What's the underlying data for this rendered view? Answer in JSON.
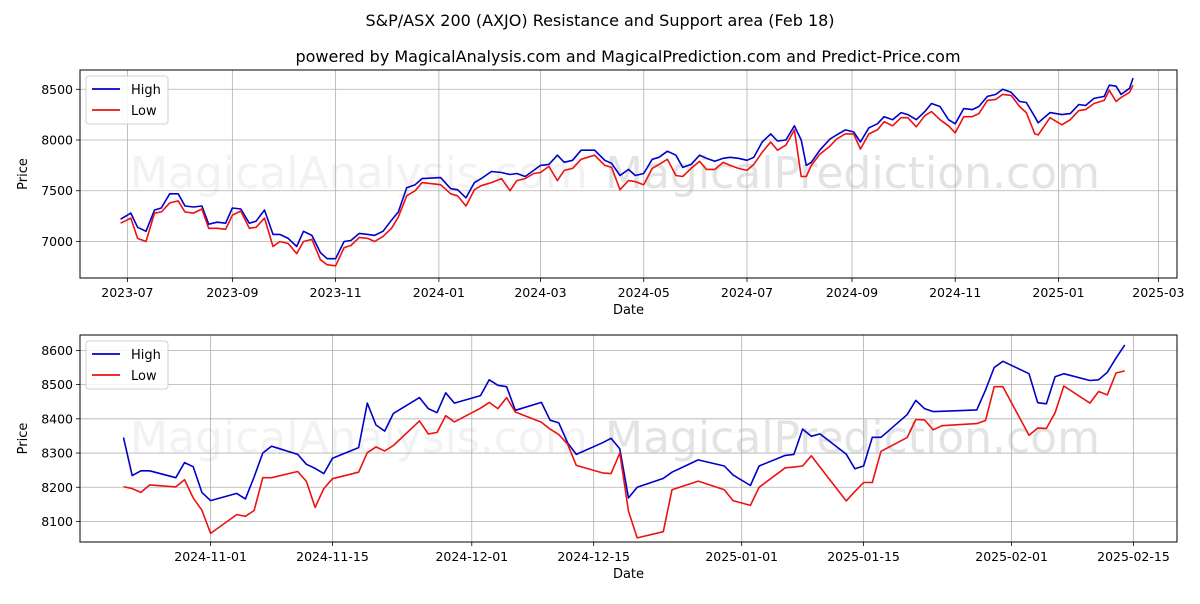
{
  "title": "S&P/ASX 200 (AXJO) Resistance and Support area (Feb 18)",
  "subtitle": "powered by MagicalAnalysis.com and MagicalPrediction.com and Predict-Price.com",
  "watermarks": [
    "MagicalAnalysis.com",
    "MagicalPrediction.com"
  ],
  "colors": {
    "high": "#0000cc",
    "low": "#ee1111",
    "grid": "#b0b0b0"
  },
  "chart_data": [
    {
      "type": "line",
      "title": "",
      "xlabel": "Date",
      "ylabel": "Price",
      "grid": true,
      "legend": {
        "placement": "top-left",
        "entries": [
          "High",
          "Low"
        ]
      },
      "xlim": [
        "2023-06-03",
        "2025-03-12"
      ],
      "ylim": [
        6640,
        8690
      ],
      "x_ticks": [
        "2023-07",
        "2023-09",
        "2023-11",
        "2024-01",
        "2024-03",
        "2024-05",
        "2024-07",
        "2024-09",
        "2024-11",
        "2025-01",
        "2025-03"
      ],
      "y_ticks": [
        7000,
        7500,
        8000,
        8500
      ],
      "x": [
        "2023-06-27",
        "2023-07-03",
        "2023-07-07",
        "2023-07-12",
        "2023-07-17",
        "2023-07-21",
        "2023-07-26",
        "2023-07-31",
        "2023-08-04",
        "2023-08-09",
        "2023-08-14",
        "2023-08-18",
        "2023-08-23",
        "2023-08-28",
        "2023-09-01",
        "2023-09-06",
        "2023-09-11",
        "2023-09-15",
        "2023-09-20",
        "2023-09-25",
        "2023-09-29",
        "2023-10-04",
        "2023-10-09",
        "2023-10-13",
        "2023-10-18",
        "2023-10-23",
        "2023-10-27",
        "2023-11-01",
        "2023-11-06",
        "2023-11-10",
        "2023-11-15",
        "2023-11-20",
        "2023-11-24",
        "2023-11-29",
        "2023-12-04",
        "2023-12-08",
        "2023-12-13",
        "2023-12-18",
        "2023-12-22",
        "2024-01-02",
        "2024-01-08",
        "2024-01-12",
        "2024-01-17",
        "2024-01-22",
        "2024-01-26",
        "2024-02-01",
        "2024-02-07",
        "2024-02-12",
        "2024-02-16",
        "2024-02-21",
        "2024-02-26",
        "2024-03-01",
        "2024-03-06",
        "2024-03-11",
        "2024-03-15",
        "2024-03-20",
        "2024-03-25",
        "2024-04-02",
        "2024-04-08",
        "2024-04-12",
        "2024-04-17",
        "2024-04-22",
        "2024-04-26",
        "2024-05-01",
        "2024-05-06",
        "2024-05-10",
        "2024-05-15",
        "2024-05-20",
        "2024-05-24",
        "2024-05-29",
        "2024-06-03",
        "2024-06-07",
        "2024-06-12",
        "2024-06-17",
        "2024-06-21",
        "2024-06-26",
        "2024-07-01",
        "2024-07-05",
        "2024-07-10",
        "2024-07-15",
        "2024-07-19",
        "2024-07-24",
        "2024-07-29",
        "2024-08-02",
        "2024-08-05",
        "2024-08-08",
        "2024-08-13",
        "2024-08-19",
        "2024-08-23",
        "2024-08-28",
        "2024-09-02",
        "2024-09-06",
        "2024-09-11",
        "2024-09-16",
        "2024-09-20",
        "2024-09-25",
        "2024-09-30",
        "2024-10-04",
        "2024-10-09",
        "2024-10-14",
        "2024-10-18",
        "2024-10-23",
        "2024-10-28",
        "2024-11-01",
        "2024-11-06",
        "2024-11-11",
        "2024-11-15",
        "2024-11-20",
        "2024-11-25",
        "2024-11-29",
        "2024-12-04",
        "2024-12-09",
        "2024-12-13",
        "2024-12-18",
        "2024-12-20",
        "2024-12-27",
        "2025-01-03",
        "2025-01-08",
        "2025-01-13",
        "2025-01-17",
        "2025-01-22",
        "2025-01-28",
        "2025-01-31",
        "2025-02-04",
        "2025-02-07",
        "2025-02-12",
        "2025-02-14"
      ],
      "series": [
        {
          "name": "High",
          "values": [
            7220,
            7280,
            7140,
            7100,
            7310,
            7330,
            7470,
            7470,
            7350,
            7340,
            7350,
            7170,
            7190,
            7180,
            7330,
            7320,
            7180,
            7200,
            7310,
            7070,
            7070,
            7030,
            6950,
            7100,
            7060,
            6890,
            6830,
            6830,
            7000,
            7010,
            7080,
            7070,
            7060,
            7100,
            7210,
            7290,
            7530,
            7560,
            7620,
            7630,
            7520,
            7510,
            7430,
            7580,
            7620,
            7690,
            7680,
            7660,
            7670,
            7640,
            7700,
            7750,
            7760,
            7850,
            7780,
            7800,
            7900,
            7900,
            7800,
            7770,
            7650,
            7710,
            7650,
            7670,
            7810,
            7830,
            7890,
            7850,
            7730,
            7760,
            7850,
            7820,
            7790,
            7820,
            7830,
            7820,
            7800,
            7830,
            7980,
            8060,
            7990,
            8000,
            8140,
            8000,
            7750,
            7780,
            7900,
            8010,
            8050,
            8100,
            8080,
            7980,
            8120,
            8160,
            8230,
            8200,
            8270,
            8250,
            8200,
            8280,
            8360,
            8330,
            8200,
            8160,
            8310,
            8300,
            8330,
            8430,
            8450,
            8500,
            8470,
            8380,
            8370,
            8230,
            8170,
            8270,
            8250,
            8260,
            8350,
            8340,
            8410,
            8430,
            8540,
            8530,
            8450,
            8510,
            8610
          ]
        },
        {
          "name": "Low",
          "values": [
            7180,
            7230,
            7030,
            7000,
            7280,
            7290,
            7380,
            7400,
            7290,
            7280,
            7320,
            7130,
            7130,
            7120,
            7260,
            7300,
            7130,
            7140,
            7230,
            6950,
            7000,
            6980,
            6880,
            7000,
            7020,
            6820,
            6770,
            6760,
            6940,
            6960,
            7040,
            7030,
            7000,
            7050,
            7130,
            7240,
            7450,
            7500,
            7580,
            7560,
            7470,
            7450,
            7350,
            7510,
            7550,
            7580,
            7620,
            7500,
            7600,
            7620,
            7670,
            7680,
            7740,
            7600,
            7700,
            7720,
            7810,
            7850,
            7750,
            7730,
            7510,
            7600,
            7590,
            7560,
            7720,
            7760,
            7810,
            7650,
            7640,
            7720,
            7790,
            7710,
            7710,
            7780,
            7750,
            7720,
            7700,
            7760,
            7880,
            7980,
            7900,
            7950,
            8100,
            7640,
            7640,
            7750,
            7860,
            7940,
            8010,
            8060,
            8060,
            7910,
            8060,
            8100,
            8180,
            8140,
            8220,
            8220,
            8130,
            8240,
            8280,
            8200,
            8140,
            8070,
            8230,
            8230,
            8260,
            8390,
            8400,
            8450,
            8440,
            8330,
            8270,
            8060,
            8050,
            8220,
            8150,
            8200,
            8290,
            8300,
            8360,
            8390,
            8490,
            8380,
            8420,
            8470,
            8540
          ]
        }
      ]
    },
    {
      "type": "line",
      "title": "",
      "xlabel": "Date",
      "ylabel": "Price",
      "grid": true,
      "legend": {
        "placement": "top-left",
        "entries": [
          "High",
          "Low"
        ]
      },
      "xlim": [
        "2024-10-17",
        "2025-02-20"
      ],
      "ylim": [
        8040,
        8645
      ],
      "x_ticks": [
        "2024-11-01",
        "2024-11-15",
        "2024-12-01",
        "2024-12-15",
        "2025-01-01",
        "2025-01-15",
        "2025-02-01",
        "2025-02-15"
      ],
      "x_tick_labels": [
        "2024-11-01",
        "2024-11-15",
        "2024-12-01",
        "2024-12-15",
        "2025-01-01",
        "2025-01-15",
        "2025-02-01",
        "2025-02-15"
      ],
      "y_ticks": [
        8100,
        8200,
        8300,
        8400,
        8500,
        8600
      ],
      "x": [
        "2024-10-22",
        "2024-10-23",
        "2024-10-24",
        "2024-10-25",
        "2024-10-28",
        "2024-10-29",
        "2024-10-30",
        "2024-10-31",
        "2024-11-01",
        "2024-11-04",
        "2024-11-05",
        "2024-11-06",
        "2024-11-07",
        "2024-11-08",
        "2024-11-11",
        "2024-11-12",
        "2024-11-13",
        "2024-11-14",
        "2024-11-15",
        "2024-11-18",
        "2024-11-19",
        "2024-11-20",
        "2024-11-21",
        "2024-11-22",
        "2024-11-25",
        "2024-11-26",
        "2024-11-27",
        "2024-11-28",
        "2024-11-29",
        "2024-12-02",
        "2024-12-03",
        "2024-12-04",
        "2024-12-05",
        "2024-12-06",
        "2024-12-09",
        "2024-12-10",
        "2024-12-11",
        "2024-12-12",
        "2024-12-13",
        "2024-12-16",
        "2024-12-17",
        "2024-12-18",
        "2024-12-19",
        "2024-12-20",
        "2024-12-23",
        "2024-12-24",
        "2024-12-27",
        "2024-12-30",
        "2024-12-31",
        "2025-01-02",
        "2025-01-03",
        "2025-01-06",
        "2025-01-07",
        "2025-01-08",
        "2025-01-09",
        "2025-01-10",
        "2025-01-13",
        "2025-01-14",
        "2025-01-15",
        "2025-01-16",
        "2025-01-17",
        "2025-01-20",
        "2025-01-21",
        "2025-01-22",
        "2025-01-23",
        "2025-01-24",
        "2025-01-28",
        "2025-01-29",
        "2025-01-30",
        "2025-01-31",
        "2025-02-03",
        "2025-02-04",
        "2025-02-05",
        "2025-02-06",
        "2025-02-07",
        "2025-02-10",
        "2025-02-11",
        "2025-02-12",
        "2025-02-13",
        "2025-02-14"
      ],
      "series": [
        {
          "name": "High",
          "values": [
            8345,
            8234,
            8248,
            8248,
            8228,
            8272,
            8260,
            8185,
            8161,
            8182,
            8166,
            8230,
            8300,
            8320,
            8296,
            8267,
            8255,
            8240,
            8285,
            8316,
            8446,
            8382,
            8364,
            8416,
            8462,
            8430,
            8418,
            8476,
            8446,
            8468,
            8514,
            8498,
            8494,
            8425,
            8448,
            8396,
            8388,
            8330,
            8296,
            8330,
            8343,
            8312,
            8169,
            8200,
            8226,
            8244,
            8280,
            8262,
            8236,
            8205,
            8262,
            8293,
            8296,
            8370,
            8349,
            8356,
            8297,
            8254,
            8262,
            8346,
            8346,
            8412,
            8454,
            8430,
            8421,
            8422,
            8426,
            8484,
            8550,
            8568,
            8532,
            8447,
            8444,
            8523,
            8532,
            8512,
            8514,
            8536,
            8578,
            8616
          ]
        },
        {
          "name": "Low",
          "values": [
            8202,
            8196,
            8185,
            8207,
            8201,
            8222,
            8169,
            8133,
            8065,
            8120,
            8115,
            8132,
            8228,
            8228,
            8246,
            8217,
            8141,
            8196,
            8225,
            8244,
            8301,
            8318,
            8306,
            8322,
            8394,
            8356,
            8360,
            8409,
            8391,
            8431,
            8448,
            8430,
            8462,
            8420,
            8390,
            8370,
            8354,
            8326,
            8264,
            8242,
            8240,
            8300,
            8130,
            8052,
            8070,
            8193,
            8218,
            8193,
            8161,
            8147,
            8200,
            8257,
            8259,
            8262,
            8292,
            8259,
            8160,
            8188,
            8214,
            8214,
            8305,
            8345,
            8398,
            8397,
            8368,
            8380,
            8386,
            8395,
            8494,
            8494,
            8352,
            8373,
            8372,
            8418,
            8496,
            8446,
            8480,
            8470,
            8534,
            8540
          ]
        }
      ]
    }
  ]
}
